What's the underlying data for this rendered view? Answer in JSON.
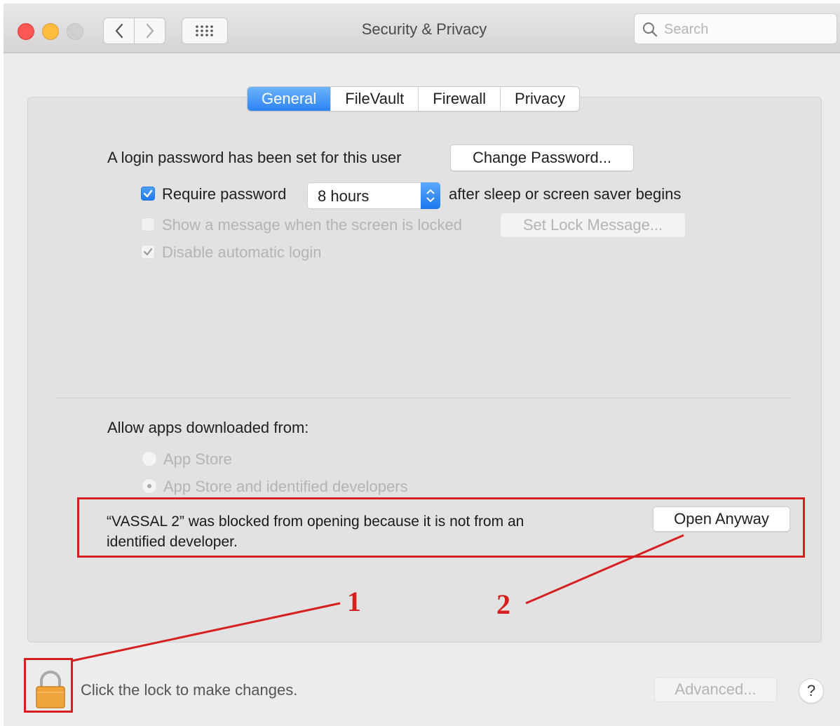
{
  "window": {
    "title": "Security & Privacy",
    "search_placeholder": "Search"
  },
  "tabs": [
    {
      "label": "General",
      "active": true
    },
    {
      "label": "FileVault",
      "active": false
    },
    {
      "label": "Firewall",
      "active": false
    },
    {
      "label": "Privacy",
      "active": false
    }
  ],
  "general": {
    "password_set_text": "A login password has been set for this user",
    "change_password_button": "Change Password...",
    "require_password_label": "Require password",
    "require_password_checked": true,
    "require_password_value": "8 hours",
    "after_sleep_text": "after sleep or screen saver begins",
    "show_message_label": "Show a message when the screen is locked",
    "show_message_checked": false,
    "set_lock_message_button": "Set Lock Message...",
    "disable_auto_login_label": "Disable automatic login",
    "disable_auto_login_checked": true
  },
  "downloads": {
    "heading": "Allow apps downloaded from:",
    "options": [
      {
        "label": "App Store",
        "selected": false
      },
      {
        "label": "App Store and identified developers",
        "selected": true
      }
    ],
    "blocked_line1": "“VASSAL 2” was blocked from opening because it is not from an",
    "blocked_line2": "identified developer.",
    "open_anyway_button": "Open Anyway"
  },
  "footer": {
    "lock_text": "Click the lock to make changes.",
    "advanced_button": "Advanced...",
    "help_button": "?"
  },
  "annotations": {
    "step1": "1",
    "step2": "2"
  },
  "colors": {
    "accent": "#2c83f4",
    "annotation_red": "#d62020",
    "lock_gold": "#f0a53a"
  }
}
